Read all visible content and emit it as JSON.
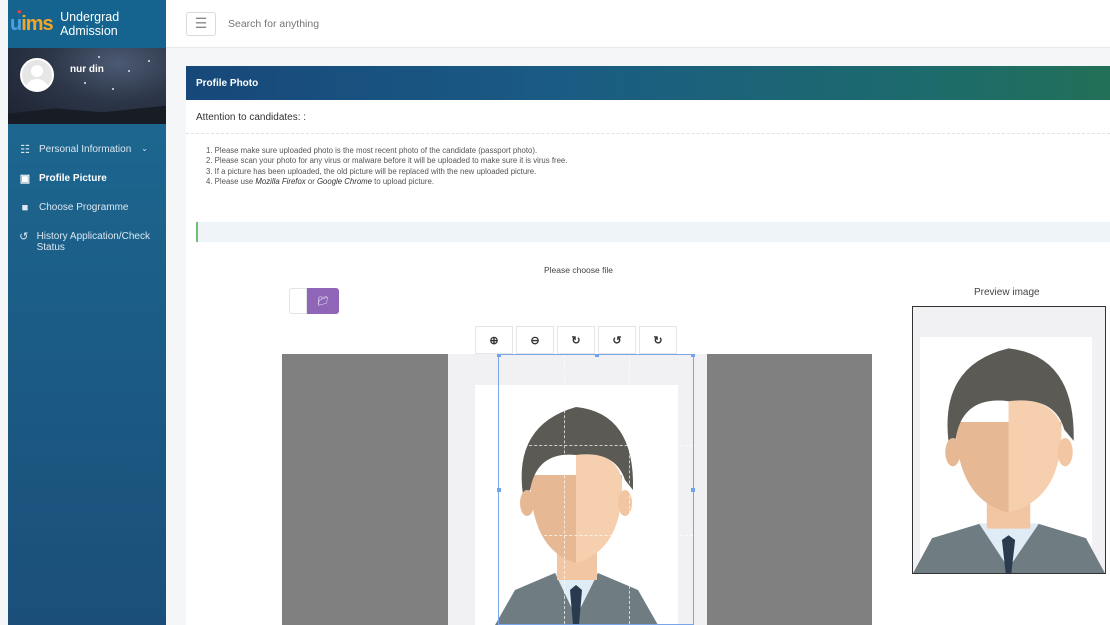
{
  "sidebar": {
    "logo_text": "uims",
    "app_title": "Undergrad Admission",
    "user_name": "nur din",
    "items": [
      {
        "label": "Personal Information",
        "icon": "id-card-icon",
        "glyph": "☷",
        "has_chevron": true
      },
      {
        "label": "Profile Picture",
        "icon": "camera-icon",
        "glyph": "▣",
        "active": true
      },
      {
        "label": "Choose Programme",
        "icon": "book-icon",
        "glyph": "■"
      },
      {
        "label": "History Application/Check Status",
        "icon": "history-icon",
        "glyph": "↺"
      }
    ]
  },
  "topbar": {
    "menu_icon": "hamburger-icon",
    "search_placeholder": "Search for anything"
  },
  "card": {
    "title": "Profile Photo",
    "attention": "Attention to candidates: :",
    "notes": [
      "1. Please make sure uploaded photo is the most recent photo of the candidate (passport photo).",
      "2. Please scan your photo for any virus or malware before it will be uploaded to make sure it is virus free.",
      "3. If a picture has been uploaded, the old picture will be replaced with the new uploaded picture."
    ],
    "note4": {
      "prefix": "4. Please use ",
      "firefox": "Mozilla Firefox",
      "or": " or ",
      "chrome": "Google Chrome",
      "suffix": " to upload picture."
    },
    "choose_file_label": "Please choose file",
    "preview_label": "Preview image",
    "tools": [
      {
        "name": "zoom-in-icon",
        "glyph": "⊕"
      },
      {
        "name": "zoom-out-icon",
        "glyph": "⊖"
      },
      {
        "name": "refresh-icon",
        "glyph": "↻"
      },
      {
        "name": "rotate-left-icon",
        "glyph": "↺"
      },
      {
        "name": "rotate-right-icon",
        "glyph": "↻"
      }
    ]
  },
  "colors": {
    "sidebar": "#1b5d86",
    "header_gradient_start": "#17487a",
    "header_gradient_end": "#227057",
    "file_button": "#8f65b8",
    "cropper_bg": "#808080",
    "crop_border": "#7aa5e6"
  }
}
